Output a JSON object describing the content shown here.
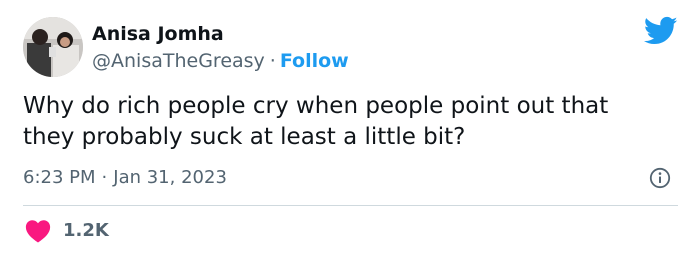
{
  "tweet": {
    "author_name": "Anisa Jomha",
    "handle": "@AnisaTheGreasy",
    "separator": "·",
    "follow_label": "Follow",
    "text": "Why do rich people cry when people point out that\nthey probably suck at least a little bit?",
    "time": "6:23 PM",
    "date": "Jan 31, 2023",
    "likes": "1.2K"
  },
  "icons": {
    "brand": "twitter-bird-icon",
    "info": "info-icon",
    "like": "heart-icon"
  },
  "colors": {
    "brand_blue": "#1d9bf0",
    "like_red": "#f91880",
    "secondary_text": "#536471",
    "primary_text": "#0f1419",
    "divider": "#cfd9de"
  }
}
